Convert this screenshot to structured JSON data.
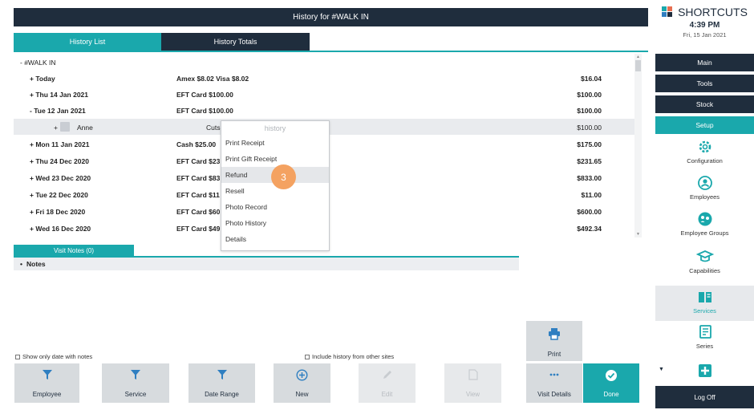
{
  "title": "History for #WALK IN",
  "tabs": [
    {
      "label": "History List",
      "active": true
    },
    {
      "label": "History Totals",
      "active": false
    }
  ],
  "history": {
    "root_label": "- #WALK IN",
    "rows": [
      {
        "label": "+ Today",
        "detail": "Amex $8.02  Visa $8.02",
        "amount": "$16.04"
      },
      {
        "label": "+ Thu 14 Jan 2021",
        "detail": "EFT Card $100.00",
        "amount": "$100.00"
      },
      {
        "label": "- Tue 12 Jan 2021",
        "detail": "EFT Card $100.00",
        "amount": "$100.00"
      },
      {
        "label": "+",
        "name": "Anne",
        "detail": "Cuts",
        "amount": "$100.00",
        "sub": true
      },
      {
        "label": "+ Mon 11 Jan 2021",
        "detail": "Cash $25.00",
        "amount": "$175.00"
      },
      {
        "label": "+ Thu 24 Dec 2020",
        "detail": "EFT Card $23",
        "amount": "$231.65"
      },
      {
        "label": "+ Wed 23 Dec 2020",
        "detail": "EFT Card $83",
        "amount": "$833.00"
      },
      {
        "label": "+ Tue 22 Dec 2020",
        "detail": "EFT Card $11",
        "amount": "$11.00"
      },
      {
        "label": "+ Fri 18 Dec 2020",
        "detail": "EFT Card $60",
        "amount": "$600.00"
      },
      {
        "label": "+ Wed 16 Dec 2020",
        "detail": "EFT Card $49",
        "amount": "$492.34"
      }
    ]
  },
  "context_menu": {
    "title": "history",
    "items": [
      "Print Receipt",
      "Print Gift Receipt",
      "Refund",
      "Resell",
      "Photo Record",
      "Photo History",
      "Details"
    ],
    "highlighted": "Refund"
  },
  "step_badge": "3",
  "notes": {
    "tab_label": "Visit Notes (0)",
    "header": "Notes",
    "bullet": "•"
  },
  "options": {
    "show_only_notes": "Show only date with notes",
    "include_other_sites": "Include history from other sites"
  },
  "buttons": {
    "print": "Print",
    "employee": "Employee",
    "service": "Service",
    "date_range": "Date Range",
    "new": "New",
    "edit": "Edit",
    "view": "View",
    "visit_details": "Visit Details",
    "done": "Done"
  },
  "sidebar": {
    "brand": "SHORTCUTS",
    "time": "4:39 PM",
    "date": "Fri, 15 Jan 2021",
    "nav": [
      {
        "label": "Main",
        "active": false
      },
      {
        "label": "Tools",
        "active": false
      },
      {
        "label": "Stock",
        "active": false
      },
      {
        "label": "Setup",
        "active": true
      }
    ],
    "items": [
      {
        "label": "Configuration",
        "icon": "gear-icon"
      },
      {
        "label": "Employees",
        "icon": "person-icon"
      },
      {
        "label": "Employee Groups",
        "icon": "group-icon"
      },
      {
        "label": "Capabilities",
        "icon": "graduation-cap-icon"
      },
      {
        "label": "Services",
        "icon": "book-icon",
        "current": true
      },
      {
        "label": "Series",
        "icon": "list-icon"
      },
      {
        "label": "",
        "icon": "plus-icon"
      }
    ],
    "logoff": "Log Off"
  },
  "colors": {
    "teal": "#1aa8ac",
    "navy": "#1f2d3d",
    "badge": "#f4a261"
  }
}
